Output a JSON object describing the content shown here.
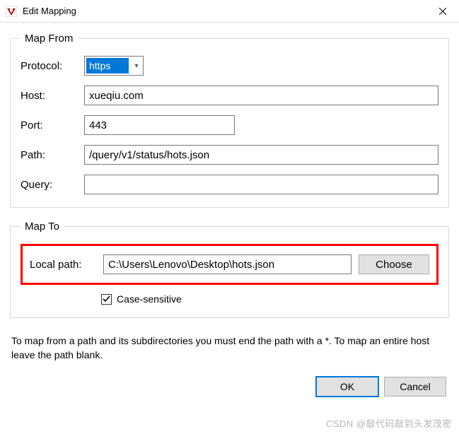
{
  "window": {
    "title": "Edit Mapping"
  },
  "mapFrom": {
    "legend": "Map From",
    "protocolLabel": "Protocol:",
    "protocolValue": "https",
    "hostLabel": "Host:",
    "hostValue": "xueqiu.com",
    "portLabel": "Port:",
    "portValue": "443",
    "pathLabel": "Path:",
    "pathValue": "/query/v1/status/hots.json",
    "queryLabel": "Query:",
    "queryValue": ""
  },
  "mapTo": {
    "legend": "Map To",
    "localPathLabel": "Local path:",
    "localPathValue": "C:\\Users\\Lenovo\\Desktop\\hots.json",
    "chooseLabel": "Choose",
    "caseSensitiveLabel": "Case-sensitive",
    "caseSensitiveChecked": true
  },
  "hintText": "To map from a path and its subdirectories you must end the path with a *. To map an entire host leave the path blank.",
  "buttons": {
    "ok": "OK",
    "cancel": "Cancel"
  },
  "watermark": "CSDN @敲代码敲到头发茂密"
}
